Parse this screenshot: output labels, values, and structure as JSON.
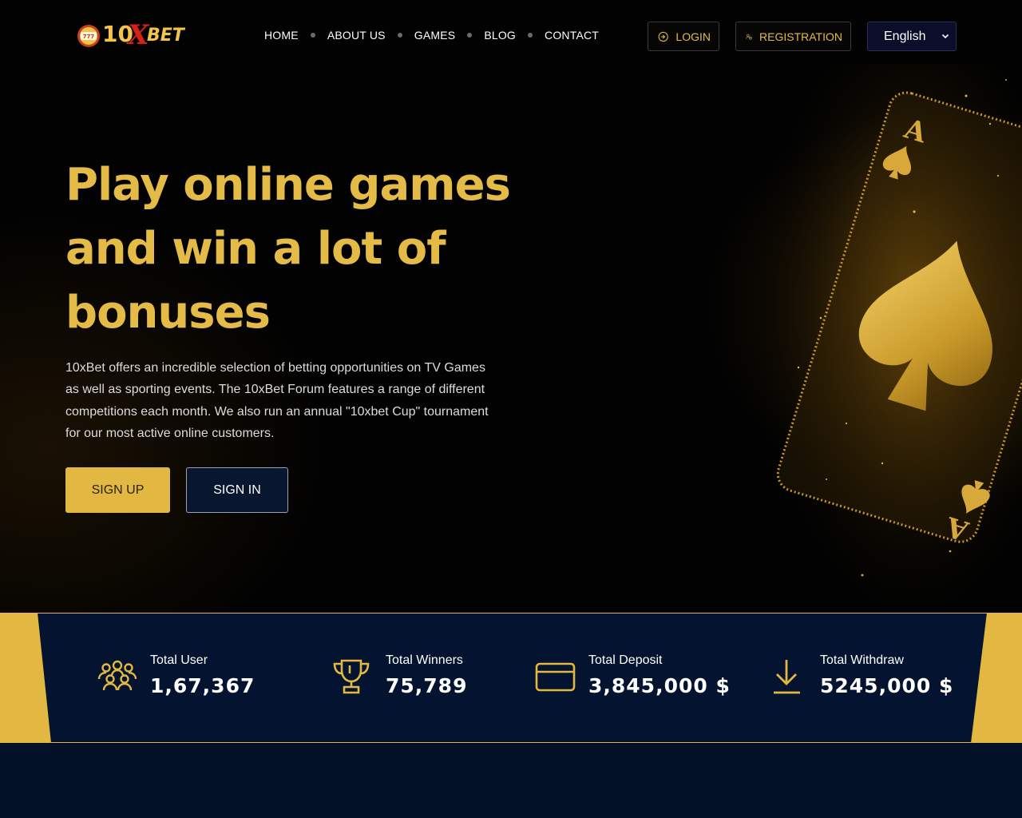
{
  "brand": {
    "logo_text_10": "10",
    "logo_text_x": "X",
    "logo_text_bet": "BET"
  },
  "nav": {
    "items": [
      {
        "label": "HOME"
      },
      {
        "label": "ABOUT US"
      },
      {
        "label": "GAMES"
      },
      {
        "label": "BLOG"
      },
      {
        "label": "CONTACT"
      }
    ]
  },
  "header": {
    "login_label": "LOGIN",
    "register_label": "REGISTRATION",
    "language": "English"
  },
  "hero": {
    "title_line1": "Play online games",
    "title_line2": "and win a lot of",
    "title_line3": "bonuses",
    "description": "10xBet offers an incredible selection of betting opportunities on TV Games as well as sporting events. The 10xBet Forum features a range of different competitions each month. We also run an annual \"10xbet Cup\" tournament for our most active online customers.",
    "signup_label": "SIGN UP",
    "signin_label": "SIGN IN"
  },
  "stats": [
    {
      "label": "Total User",
      "value": "1,67,367",
      "icon": "users-icon"
    },
    {
      "label": "Total Winners",
      "value": "75,789",
      "icon": "trophy-icon"
    },
    {
      "label": "Total Deposit",
      "value": "3,845,000 $",
      "icon": "credit-card-icon"
    },
    {
      "label": "Total Withdraw",
      "value": "5245,000 $",
      "icon": "download-icon"
    }
  ],
  "colors": {
    "gold": "#e3bb46",
    "navy": "#031330",
    "bg": "#020202"
  }
}
